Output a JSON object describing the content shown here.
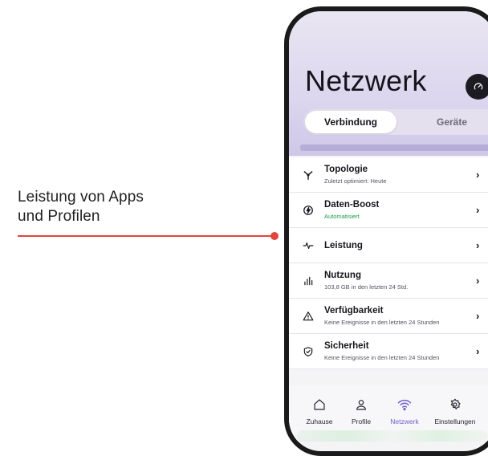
{
  "callout": {
    "line1": "Leistung von Apps",
    "line2": "und Profilen"
  },
  "header": {
    "title": "Netzwerk",
    "speed_icon": "speedometer-icon"
  },
  "segmented": {
    "active": "Verbindung",
    "inactive": "Geräte"
  },
  "list": [
    {
      "icon": "topology-icon",
      "title": "Topologie",
      "subtitle": "Zuletzt optimiert: Heute"
    },
    {
      "icon": "boost-icon",
      "title": "Daten-Boost",
      "subtitle": "Automatisiert",
      "subtitle_color": "#1c9a4a"
    },
    {
      "icon": "pulse-icon",
      "title": "Leistung",
      "subtitle": ""
    },
    {
      "icon": "usage-bars-icon",
      "title": "Nutzung",
      "subtitle": "103,8 GB in den letzten 24 Std."
    },
    {
      "icon": "warning-icon",
      "title": "Verfügbarkeit",
      "subtitle": "Keine Ereignisse in den letzten 24 Stunden"
    },
    {
      "icon": "shield-check-icon",
      "title": "Sicherheit",
      "subtitle": "Keine Ereignisse in den letzten 24 Stunden"
    }
  ],
  "tabbar": {
    "items": [
      {
        "icon": "home-icon",
        "label": "Zuhause"
      },
      {
        "icon": "profile-icon",
        "label": "Profile"
      },
      {
        "icon": "wifi-icon",
        "label": "Netzwerk"
      },
      {
        "icon": "settings-gear-icon",
        "label": "Einstellungen"
      }
    ],
    "active_color": "#6f63c9"
  },
  "colors": {
    "accent": "#e0463a",
    "header_tint": "#cfc7e8"
  }
}
